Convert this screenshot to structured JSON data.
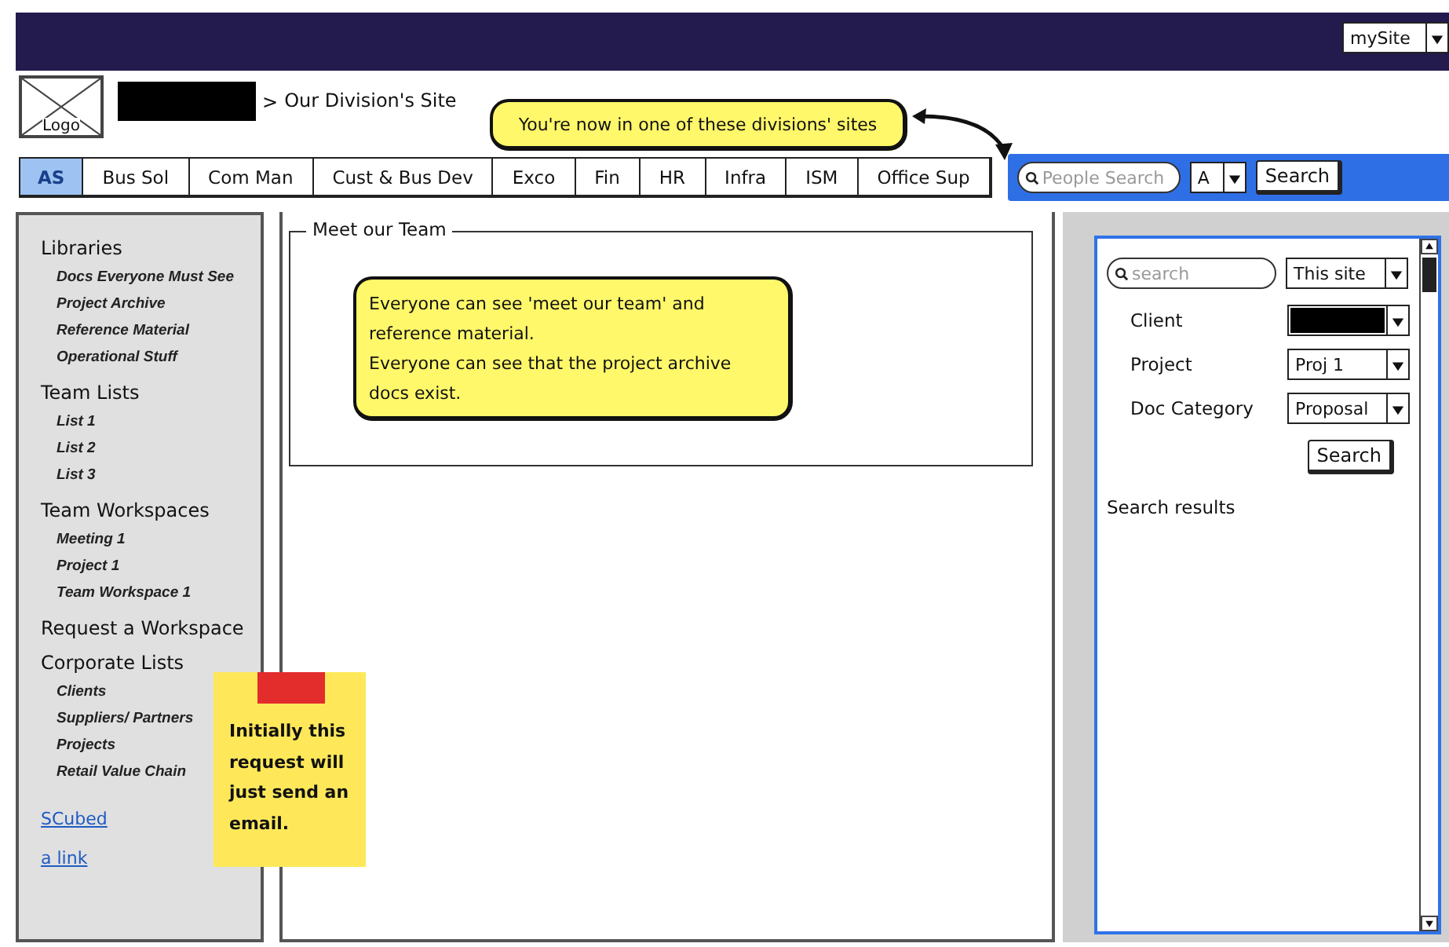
{
  "top_bar": {
    "site_menu": "mySite"
  },
  "header": {
    "logo": "Logo",
    "name_redacted": true,
    "separator": ">",
    "title": "Our Division's Site"
  },
  "divisions_callout": "You're now in one of these divisions' sites",
  "division_tabs": [
    {
      "label": "AS",
      "selected": true
    },
    {
      "label": "Bus Sol",
      "selected": false
    },
    {
      "label": "Com Man",
      "selected": false
    },
    {
      "label": "Cust & Bus Dev",
      "selected": false
    },
    {
      "label": "Exco",
      "selected": false
    },
    {
      "label": "Fin",
      "selected": false
    },
    {
      "label": "HR",
      "selected": false
    },
    {
      "label": "Infra",
      "selected": false
    },
    {
      "label": "ISM",
      "selected": false
    },
    {
      "label": "Office Sup",
      "selected": false
    }
  ],
  "people_search": {
    "placeholder": "People Search",
    "scope": "A",
    "button": "Search"
  },
  "sidebar": {
    "sections": [
      {
        "heading": "Libraries",
        "items": [
          "Docs Everyone Must See",
          "Project Archive",
          "Reference Material",
          "Operational Stuff"
        ]
      },
      {
        "heading": "Team Lists",
        "items": [
          "List 1",
          "List 2",
          "List 3"
        ]
      },
      {
        "heading": "Team Workspaces",
        "items": [
          "Meeting 1",
          "Project 1",
          "Team Workspace 1"
        ]
      },
      {
        "heading": "Request a Workspace"
      },
      {
        "heading": "Corporate Lists",
        "items": [
          "Clients",
          "Suppliers/ Partners",
          "Projects",
          "Retail Value Chain"
        ]
      }
    ],
    "links": [
      "SCubed",
      "a link"
    ]
  },
  "sticky_note": "Initially this request will just send an email.",
  "team_panel": {
    "title": "Meet our Team",
    "callout": [
      "Everyone can see 'meet our team' and reference material.",
      "Everyone can see that the project archive docs exist."
    ]
  },
  "search_panel": {
    "placeholder": "search",
    "scope": "This site",
    "filters": [
      {
        "label": "Client",
        "redacted": true
      },
      {
        "label": "Project",
        "value": "Proj 1",
        "redacted": false
      },
      {
        "label": "Doc Category",
        "value": "Proposal",
        "redacted": false
      }
    ],
    "button": "Search",
    "results_label": "Search results"
  }
}
